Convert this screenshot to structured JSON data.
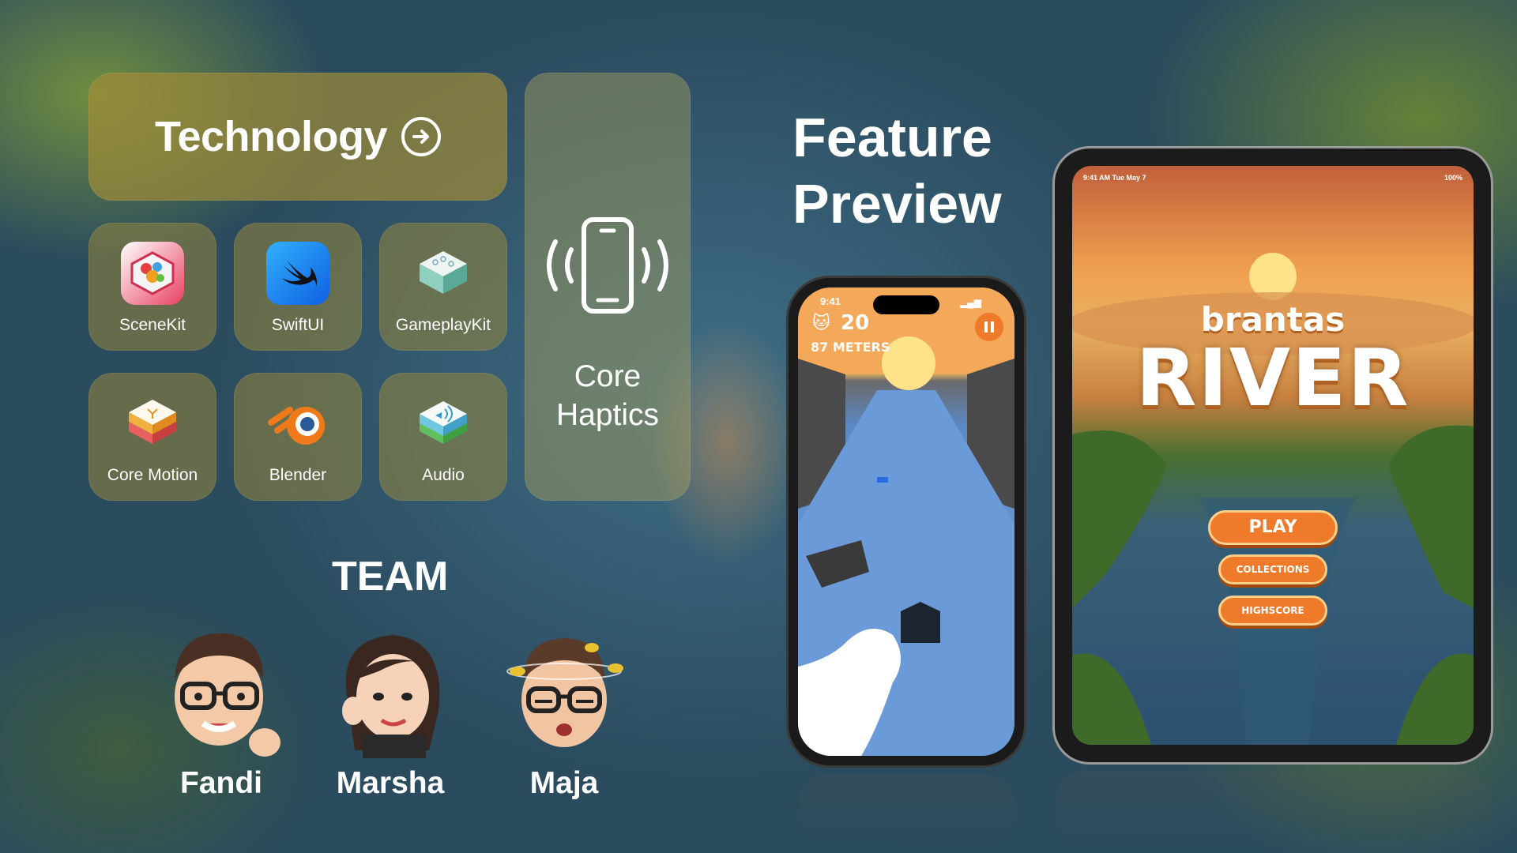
{
  "technology": {
    "title": "Technology",
    "tiles": [
      {
        "label": "SceneKit",
        "icon": "scenekit-icon"
      },
      {
        "label": "SwiftUI",
        "icon": "swiftui-icon"
      },
      {
        "label": "GameplayKit",
        "icon": "gameplaykit-icon"
      },
      {
        "label": "Core Motion",
        "icon": "core-motion-icon"
      },
      {
        "label": "Blender",
        "icon": "blender-icon"
      },
      {
        "label": "Audio",
        "icon": "audio-icon"
      }
    ],
    "haptics_label_1": "Core",
    "haptics_label_2": "Haptics"
  },
  "team": {
    "title": "TEAM",
    "members": [
      "Fandi",
      "Marsha",
      "Maja"
    ]
  },
  "feature": {
    "line1": "Feature",
    "line2": "Preview"
  },
  "phone": {
    "time": "9:41",
    "score": "20",
    "distance": "87 METERS"
  },
  "ipad": {
    "time": "9:41 AM  Tue May 7",
    "battery": "100%",
    "game_title_1": "brantas",
    "game_title_2": "RIVER",
    "play": "PLAY",
    "collections": "COLLECTIONS",
    "highscore": "HIGHSCORE"
  },
  "colors": {
    "accent_orange": "#ee7a2a",
    "glass_gold": "#a08c37"
  }
}
